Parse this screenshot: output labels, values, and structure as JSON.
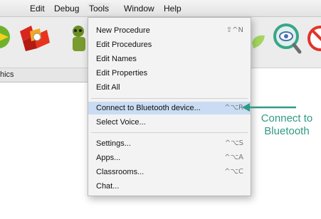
{
  "menubar": {
    "items": [
      "Edit",
      "Debug",
      "Tools",
      "Window",
      "Help"
    ]
  },
  "toolbar": {
    "tab_label": "hics"
  },
  "tools_menu": {
    "items": [
      {
        "label": "New Procedure",
        "shortcut": "⇧^N"
      },
      {
        "label": "Edit Procedures",
        "shortcut": ""
      },
      {
        "label": "Edit Names",
        "shortcut": ""
      },
      {
        "label": "Edit Properties",
        "shortcut": ""
      },
      {
        "label": "Edit All",
        "shortcut": ""
      },
      {
        "label": "Connect to Bluetooth device...",
        "shortcut": "^⌥R"
      },
      {
        "label": "Select Voice...",
        "shortcut": ""
      },
      {
        "label": "Settings...",
        "shortcut": "^⌥S"
      },
      {
        "label": "Apps...",
        "shortcut": "^⌥A"
      },
      {
        "label": "Classrooms...",
        "shortcut": "^⌥C"
      },
      {
        "label": "Chat...",
        "shortcut": ""
      }
    ]
  },
  "annotation": {
    "text": "Connect to Bluetooth"
  },
  "colors": {
    "highlight": "#c9dcf3",
    "annotation": "#2f9a83"
  }
}
